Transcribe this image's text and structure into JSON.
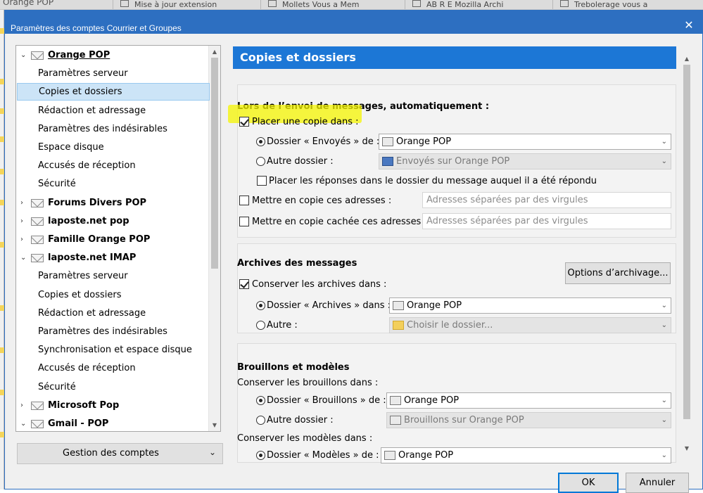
{
  "background": {
    "app_title": "Orange POP",
    "tabs": [
      "Mise à jour extension",
      "Mollets Vous a Mem",
      "AB R E Mozilla Archi",
      "Trebolerage vous a"
    ]
  },
  "dialog": {
    "title": "Paramètres des comptes Courrier et Groupes",
    "close_glyph": "✕"
  },
  "tree": {
    "rows": [
      {
        "kind": "account",
        "label": "Orange POP",
        "twisty": "⌄",
        "underline": true
      },
      {
        "kind": "sub",
        "label": "Paramètres serveur"
      },
      {
        "kind": "sub",
        "label": "Copies et dossiers",
        "selected": true
      },
      {
        "kind": "sub",
        "label": "Rédaction et adressage"
      },
      {
        "kind": "sub",
        "label": "Paramètres des indésirables"
      },
      {
        "kind": "sub",
        "label": "Espace disque"
      },
      {
        "kind": "sub",
        "label": "Accusés de réception"
      },
      {
        "kind": "sub",
        "label": "Sécurité"
      },
      {
        "kind": "account",
        "label": "Forums Divers POP",
        "twisty": "›"
      },
      {
        "kind": "account",
        "label": "laposte.net pop",
        "twisty": "›"
      },
      {
        "kind": "account",
        "label": "Famille Orange POP",
        "twisty": "›"
      },
      {
        "kind": "account",
        "label": "laposte.net IMAP",
        "twisty": "⌄"
      },
      {
        "kind": "sub",
        "label": "Paramètres serveur"
      },
      {
        "kind": "sub",
        "label": "Copies et dossiers"
      },
      {
        "kind": "sub",
        "label": "Rédaction et adressage"
      },
      {
        "kind": "sub",
        "label": "Paramètres des indésirables"
      },
      {
        "kind": "sub",
        "label": "Synchronisation et espace disque"
      },
      {
        "kind": "sub",
        "label": "Accusés de réception"
      },
      {
        "kind": "sub",
        "label": "Sécurité"
      },
      {
        "kind": "account",
        "label": "Microsoft Pop",
        "twisty": "›"
      },
      {
        "kind": "account",
        "label": "Gmail - POP",
        "twisty": "⌄"
      }
    ],
    "manage_button": "Gestion des comptes",
    "manage_chevron": "⌄"
  },
  "pane": {
    "header": "Copies et dossiers",
    "sending": {
      "title": "Lors de l’envoi de messages, automatiquement :",
      "place_copy_label": "Placer une copie dans :",
      "sent_folder_label": "Dossier « Envoyés » de :",
      "sent_folder_value": "Orange POP",
      "other_folder_label": "Autre dossier :",
      "other_folder_value": "Envoyés sur Orange POP",
      "reply_in_folder_label": "Placer les réponses dans le dossier du message auquel il a été répondu",
      "cc_label": "Mettre en copie ces adresses :",
      "cc_placeholder": "Adresses séparées par des virgules",
      "bcc_label": "Mettre en copie cachée ces adresses :",
      "bcc_placeholder": "Adresses séparées par des virgules"
    },
    "archives": {
      "title": "Archives des messages",
      "keep_archives_label": "Conserver les archives dans :",
      "options_button": "Options d’archivage...",
      "archives_folder_label": "Dossier « Archives » dans :",
      "archives_folder_value": "Orange POP",
      "other_label": "Autre :",
      "other_value": "Choisir le dossier..."
    },
    "drafts": {
      "title": "Brouillons et modèles",
      "keep_drafts_label": "Conserver les brouillons dans :",
      "drafts_folder_label": "Dossier « Brouillons » de :",
      "drafts_folder_value": "Orange POP",
      "other_folder_label": "Autre dossier :",
      "other_folder_value": "Brouillons sur Orange POP",
      "keep_templates_label": "Conserver les modèles dans :",
      "templates_folder_label": "Dossier « Modèles » de :",
      "templates_folder_value": "Orange POP"
    }
  },
  "footer": {
    "ok": "OK",
    "cancel": "Annuler"
  },
  "colors": {
    "titlebar": "#2d6fc1",
    "header": "#1c77d6",
    "selection": "#cce4f7",
    "highlight": "#f5f500"
  }
}
